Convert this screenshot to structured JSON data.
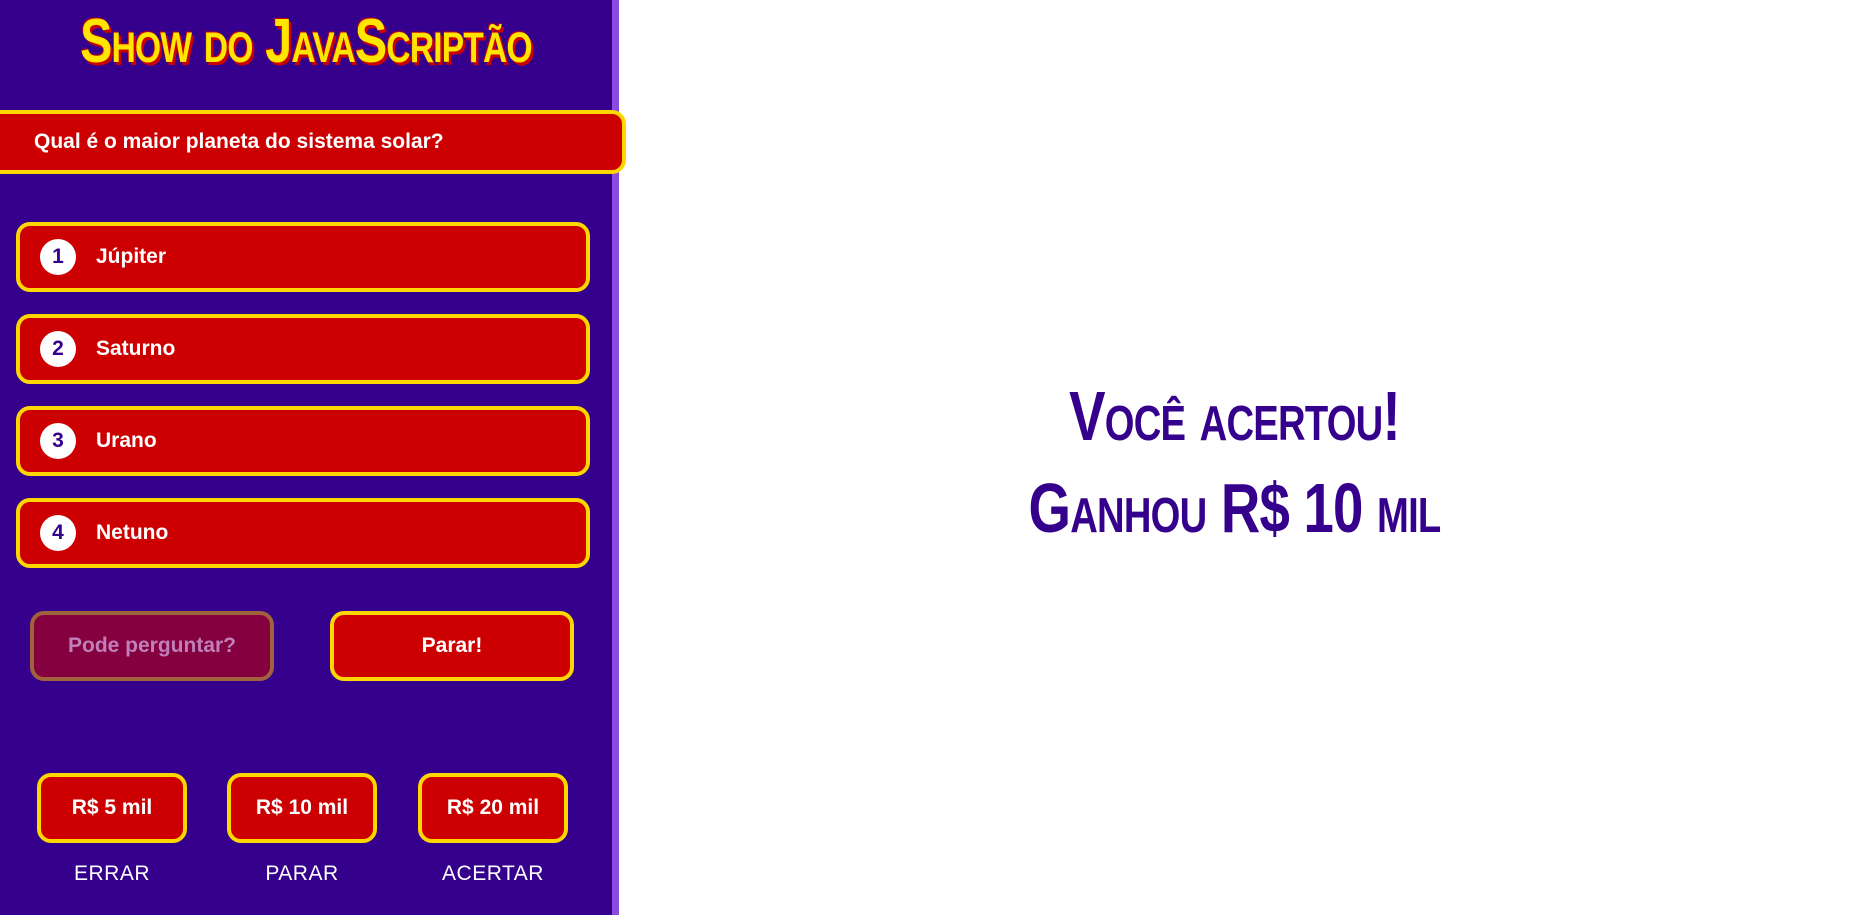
{
  "game": {
    "title": "Show do JavaScriptão"
  },
  "question": {
    "text": "Qual é o maior planeta do sistema solar?"
  },
  "answers": [
    {
      "number": "1",
      "text": "Júpiter"
    },
    {
      "number": "2",
      "text": "Saturno"
    },
    {
      "number": "3",
      "text": "Urano"
    },
    {
      "number": "4",
      "text": "Netuno"
    }
  ],
  "actions": {
    "ask_label": "Pode perguntar?",
    "stop_label": "Parar!"
  },
  "prizes": [
    {
      "amount": "R$ 5 mil",
      "label": "ERRAR"
    },
    {
      "amount": "R$ 10 mil",
      "label": "PARAR"
    },
    {
      "amount": "R$ 20 mil",
      "label": "ACERTAR"
    }
  ],
  "result": {
    "line1": "Você acertou!",
    "line2": "Ganhou R$ 10 mil"
  },
  "colors": {
    "sidebar_bg": "#35008c",
    "accent_red": "#cc0000",
    "border_yellow": "#ffd700",
    "title_yellow": "#ffe600"
  }
}
